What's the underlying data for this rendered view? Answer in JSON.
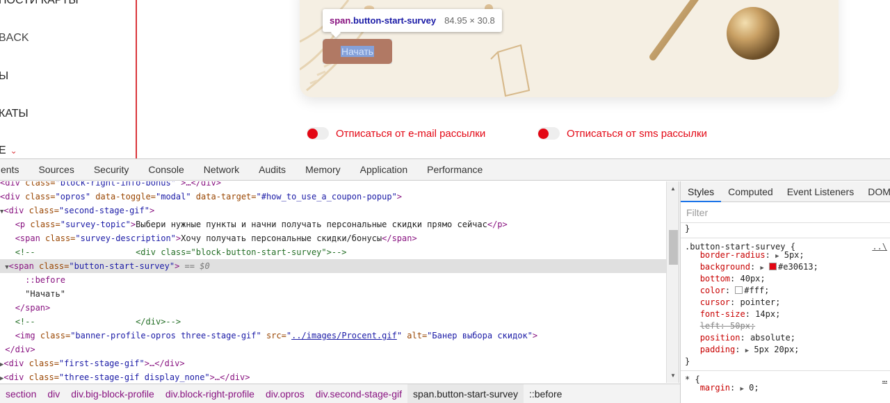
{
  "page": {
    "sidebar": {
      "items": [
        "НОСТИ КАРТЫ",
        "BACK",
        "Ы",
        "КАТЫ",
        "Е"
      ]
    },
    "button": {
      "label": "Начать"
    },
    "tooltip": {
      "tag": "span",
      "cls": ".button-start-survey",
      "size": "84.95 × 30.8"
    },
    "unsubscribe_email": "Отписаться от e-mail рассылки",
    "unsubscribe_sms": "Отписаться от sms рассылки",
    "colors": {
      "accent": "#e30613",
      "button": "#c0704a"
    }
  },
  "devtools": {
    "tabs": [
      "ents",
      "Sources",
      "Security",
      "Console",
      "Network",
      "Audits",
      "Memory",
      "Application",
      "Performance"
    ],
    "dom": {
      "l0_a": "div",
      "l0_b": " class=",
      "l0_c": "\"block-right-info-bonus\"",
      "l0_d": " >…</div>",
      "l1_tag": "div",
      "l1_a1": " class=",
      "l1_v1": "\"opros\"",
      "l1_a2": " data-toggle=",
      "l1_v2": "\"modal\"",
      "l1_a3": " data-target=",
      "l1_v3": "\"#how_to_use_a_coupon-popup\"",
      "l2_tag": "div",
      "l2_a": " class=",
      "l2_v": "\"second-stage-gif\"",
      "l3_tag": "p",
      "l3_a": " class=",
      "l3_v": "\"survey-topic\"",
      "l3_text": "Выбери нужные пункты и начни получать персональные скидки прямо сейчас",
      "l3_close": "</p>",
      "l4_tag": "span",
      "l4_a": " class=",
      "l4_v": "\"survey-description\"",
      "l4_text": "Хочу получать персональные скидки/бонусы",
      "l4_close": "</span>",
      "l5_comment": "<!--                    <div class=\"block-button-start-survey\">-->",
      "l6_tag": "span",
      "l6_a": " class=",
      "l6_v": "\"button-start-survey\"",
      "l6_ref": " == $0",
      "l7_pseudo": "::before",
      "l8_text": "\"Начать\"",
      "l9_close": "</span>",
      "l10_comment": "<!--                    </div>-->",
      "l11_tag": "img",
      "l11_a1": " class=",
      "l11_v1": "\"banner-profile-opros three-stage-gif\"",
      "l11_a2": " src=",
      "l11_q1": "\"",
      "l11_link": "../images/Procent.gif",
      "l11_q2": "\"",
      "l11_a3": " alt=",
      "l11_v3": "\"Банер выбора скидок\"",
      "l12_close": "</div>",
      "l13_tag": "div",
      "l13_a": " class=",
      "l13_v": "\"first-stage-gif\"",
      "l13_rest": ">…</div>",
      "l14_tag": "div",
      "l14_a": " class=",
      "l14_v": "\"three-stage-gif display_none\"",
      "l14_rest": ">…</div>"
    },
    "breadcrumbs": [
      "section",
      "div",
      "div.big-block-profile",
      "div.block-right-profile",
      "div.opros",
      "div.second-stage-gif",
      "span.button-start-survey",
      "::before"
    ],
    "styles": {
      "tabs": [
        "Styles",
        "Computed",
        "Event Listeners",
        "DOM"
      ],
      "filter_placeholder": "Filter",
      "brace_close": "}",
      "selector": ".button-start-survey {",
      "source": "..\\",
      "props": [
        {
          "name": "border-radius",
          "value": "5px;"
        },
        {
          "name": "background",
          "value": "#e30613;"
        },
        {
          "name": "bottom",
          "value": "40px;"
        },
        {
          "name": "color",
          "value": "#fff;"
        },
        {
          "name": "cursor",
          "value": "pointer;"
        },
        {
          "name": "font-size",
          "value": "14px;"
        },
        {
          "name": "left",
          "value": "50px;"
        },
        {
          "name": "position",
          "value": "absolute;"
        },
        {
          "name": "padding",
          "value": "5px 20px;"
        }
      ],
      "rule2_selector": "* {",
      "rule2_source": "…",
      "rule2_prop": {
        "name": "margin",
        "value": "0;"
      }
    }
  }
}
